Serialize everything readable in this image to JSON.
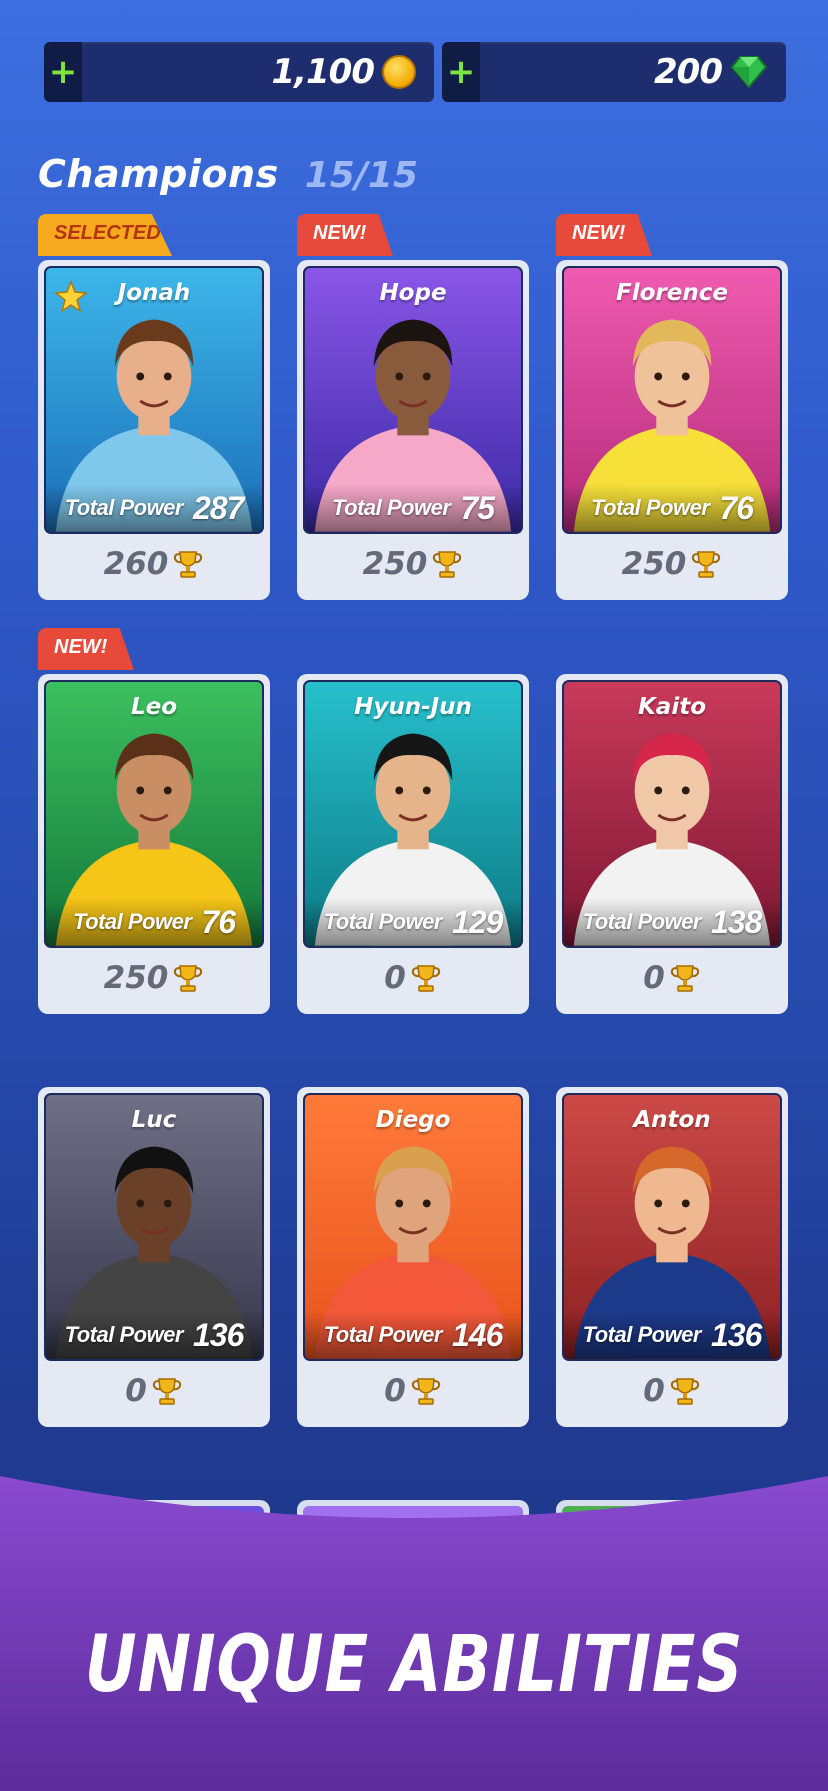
{
  "currency": {
    "coins": "1,100",
    "gems": "200",
    "plus_symbol": "+"
  },
  "heading": {
    "title": "Champions",
    "count": "15/15"
  },
  "labels": {
    "total_power": "Total Power",
    "selected_tag": "SELECTED",
    "new_tag": "NEW!"
  },
  "champions": [
    {
      "name": "Jonah",
      "power": "287",
      "trophies": "260",
      "tag": "SELECTED",
      "bg": [
        "#3db6e9",
        "#1b6fb8"
      ]
    },
    {
      "name": "Hope",
      "power": "75",
      "trophies": "250",
      "tag": "NEW!",
      "bg": [
        "#8a56e8",
        "#3b2aa5"
      ]
    },
    {
      "name": "Florence",
      "power": "76",
      "trophies": "250",
      "tag": "NEW!",
      "bg": [
        "#ef5bb0",
        "#b52b79"
      ]
    },
    {
      "name": "Leo",
      "power": "76",
      "trophies": "250",
      "tag": "NEW!",
      "bg": [
        "#3cc05e",
        "#14783a"
      ]
    },
    {
      "name": "Hyun-Jun",
      "power": "129",
      "trophies": "0",
      "tag": "",
      "bg": [
        "#27c0cc",
        "#0d7b86"
      ]
    },
    {
      "name": "Kaito",
      "power": "138",
      "trophies": "0",
      "tag": "",
      "bg": [
        "#c93a5a",
        "#7e1734"
      ]
    },
    {
      "name": "Luc",
      "power": "136",
      "trophies": "0",
      "tag": "",
      "bg": [
        "#6f6f86",
        "#36364b"
      ]
    },
    {
      "name": "Diego",
      "power": "146",
      "trophies": "0",
      "tag": "",
      "bg": [
        "#ff7a3a",
        "#e8531c"
      ]
    },
    {
      "name": "Anton",
      "power": "136",
      "trophies": "0",
      "tag": "",
      "bg": [
        "#cc4a47",
        "#8b1f22"
      ]
    }
  ],
  "banner": {
    "text": "UNIQUE ABILITIES"
  },
  "colors": {
    "accent_green": "#7ee33a",
    "tag_selected": "#f6a81f",
    "tag_new": "#e74a3a",
    "banner_purple": "#7a3fc2"
  }
}
